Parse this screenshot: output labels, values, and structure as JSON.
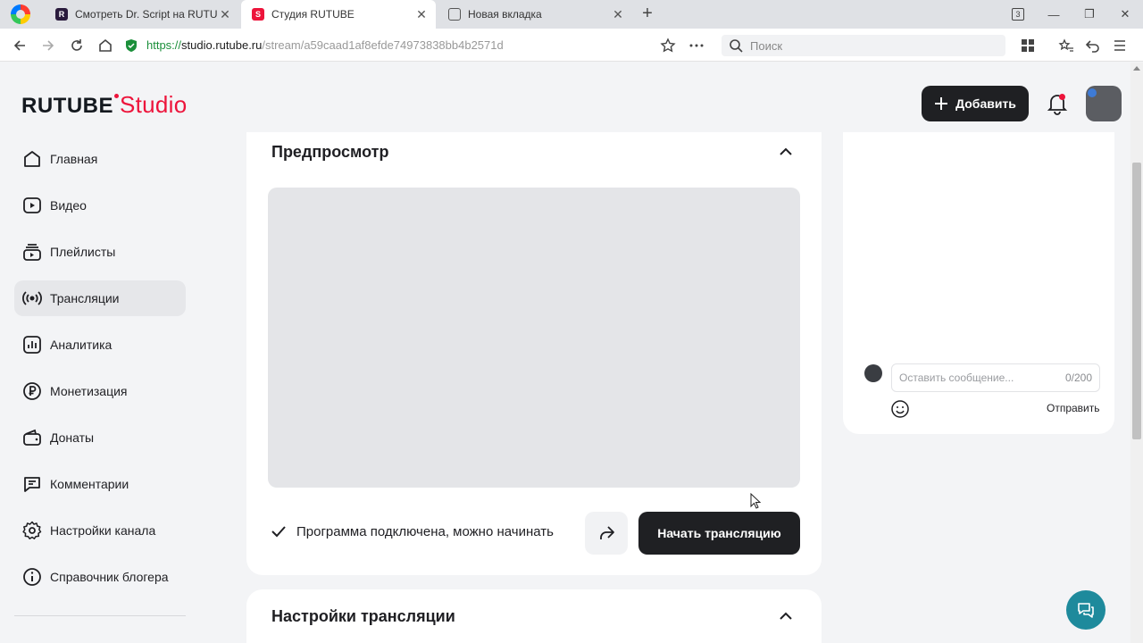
{
  "browser": {
    "tabs": [
      {
        "title": "Смотреть Dr. Script на RUTUBE",
        "active": false,
        "favicon": "rutube-favicon"
      },
      {
        "title": "Студия RUTUBE",
        "active": true,
        "favicon": "rutube-studio-favicon"
      },
      {
        "title": "Новая вкладка",
        "active": false,
        "favicon": "new-tab-favicon"
      }
    ],
    "tab_count": "3",
    "url": {
      "protocol": "https://",
      "host": "studio.rutube.ru",
      "path": "/stream/a59caad1af8efde74973838bb4b2571d"
    },
    "search_placeholder": "Поиск"
  },
  "header": {
    "logo_brand": "RUTUBE",
    "logo_product": "Studio",
    "add_label": "Добавить"
  },
  "sidebar": {
    "items": [
      {
        "label": "Главная",
        "icon": "home-icon"
      },
      {
        "label": "Видео",
        "icon": "video-icon"
      },
      {
        "label": "Плейлисты",
        "icon": "playlist-icon"
      },
      {
        "label": "Трансляции",
        "icon": "broadcast-icon",
        "active": true
      },
      {
        "label": "Аналитика",
        "icon": "analytics-icon"
      },
      {
        "label": "Монетизация",
        "icon": "ruble-icon"
      },
      {
        "label": "Донаты",
        "icon": "wallet-icon"
      },
      {
        "label": "Комментарии",
        "icon": "comment-icon"
      },
      {
        "label": "Настройки канала",
        "icon": "gear-icon"
      },
      {
        "label": "Справочник блогера",
        "icon": "info-icon"
      }
    ]
  },
  "preview": {
    "title": "Предпросмотр",
    "status": "Программа подключена, можно начинать",
    "start_label": "Начать трансляцию"
  },
  "settings": {
    "title": "Настройки трансляции"
  },
  "chat": {
    "placeholder": "Оставить сообщение...",
    "counter": "0/200",
    "send_label": "Отправить"
  },
  "colors": {
    "brand_red": "#ed143b",
    "dark_button": "#1f2023",
    "help_button": "#1e8a9c"
  }
}
